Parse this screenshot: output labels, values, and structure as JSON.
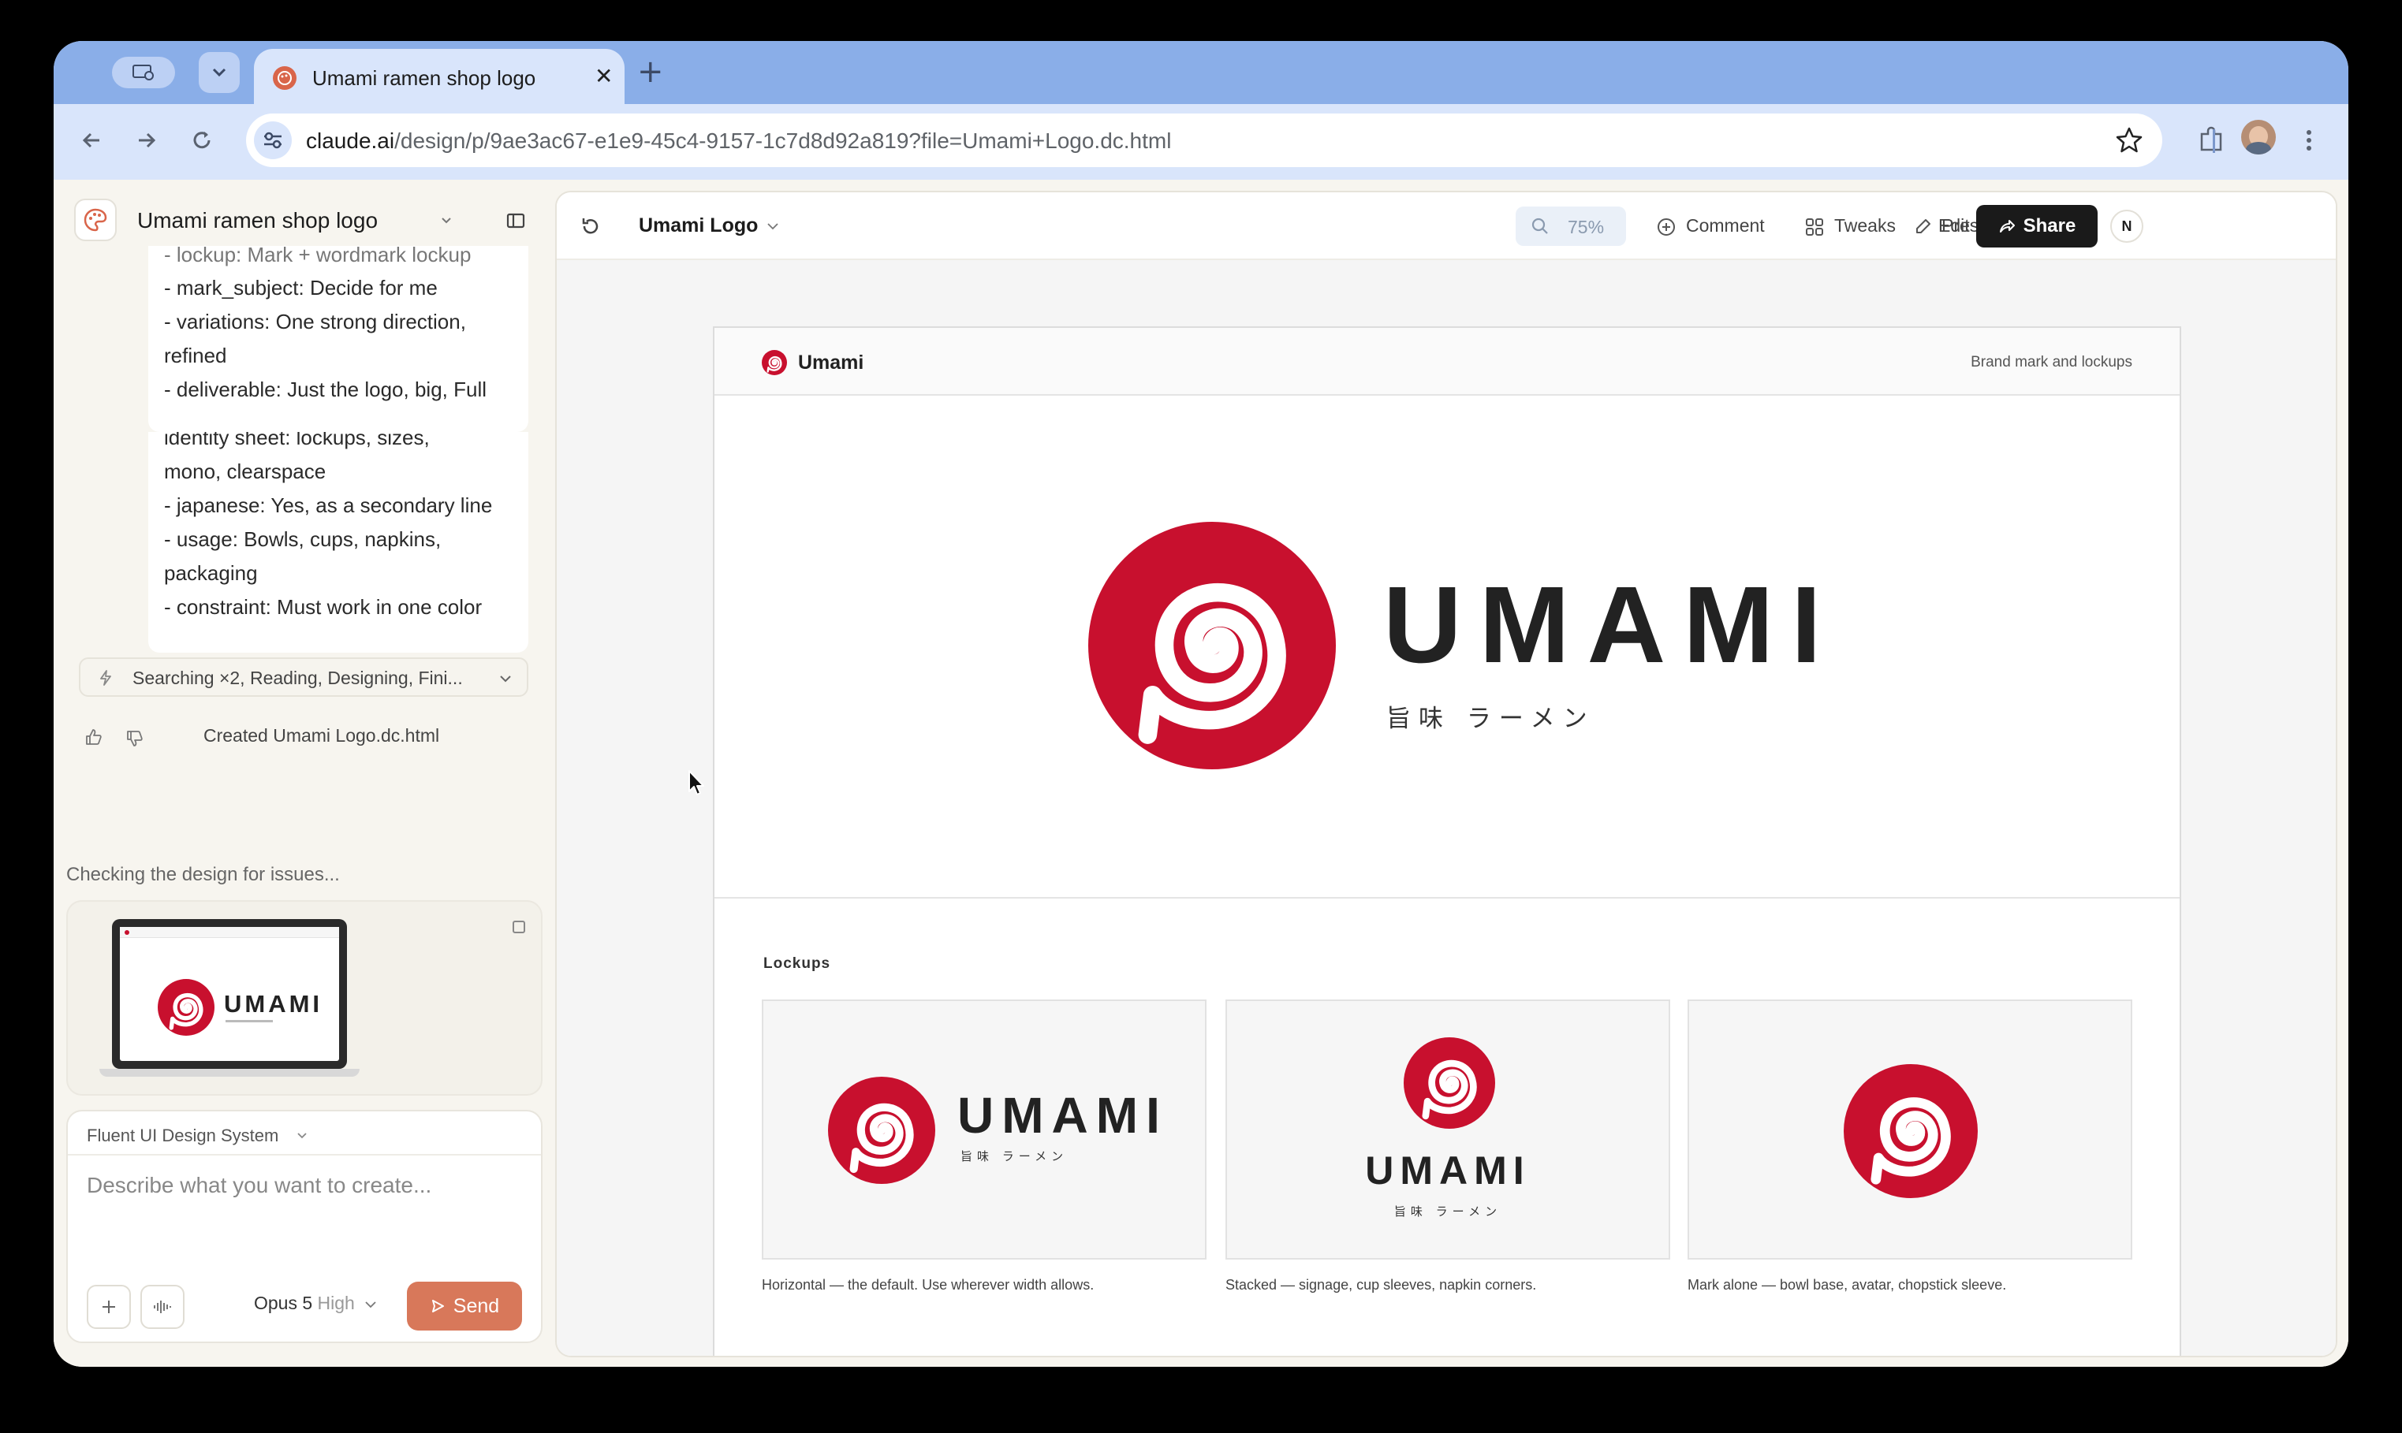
{
  "browser": {
    "tab_title": "Umami ramen shop logo",
    "url_host": "claude.ai",
    "url_path": "/design/p/9ae3ac67-e1e9-45c4-9157-1c7d8d92a819?file=Umami+Logo.dc.html"
  },
  "sidebar": {
    "project_name": "Umami ramen shop logo",
    "message_lines": [
      "- lockup: Mark + wordmark lockup",
      "- mark_subject: Decide for me",
      "- variations: One strong direction,",
      "refined",
      "- deliverable: Just the logo, big, Full",
      "identity sheet: lockups, sizes,",
      "mono, clearspace",
      "- japanese: Yes, as a secondary line",
      "- usage: Bowls, cups, napkins,",
      "packaging",
      "- constraint: Must work in one color"
    ],
    "status": "Searching ×2, Reading, Designing, Fini...",
    "created": "Created Umami Logo.dc.html",
    "checking": "Checking the design for issues...",
    "preview": {
      "wordmark": "UMAMI"
    },
    "prompt": {
      "design_system": "Fluent UI Design System",
      "placeholder": "Describe what you want to create...",
      "model": "Opus 5",
      "effort": "High",
      "send": "Send"
    }
  },
  "editor": {
    "doc_title": "Umami Logo",
    "zoom": "75%",
    "comment": "Comment",
    "tweaks": "Tweaks",
    "present": "Present",
    "edit": "Edit",
    "share": "Share",
    "user_initial": "N"
  },
  "sheet": {
    "brand": "Umami",
    "tagline": "Brand mark and lockups",
    "wordmark": "UMAMI",
    "japanese": "旨味 ラーメン",
    "lockups_title": "Lockups",
    "captions": [
      "Horizontal — the default. Use wherever width allows.",
      "Stacked — signage, cup sleeves, napkin corners.",
      "Mark alone — bowl base, avatar, chopstick sleeve."
    ]
  },
  "colors": {
    "brand_red": "#c8102e",
    "send_orange": "#d8785a",
    "tabstrip_blue": "#8aaee8"
  }
}
